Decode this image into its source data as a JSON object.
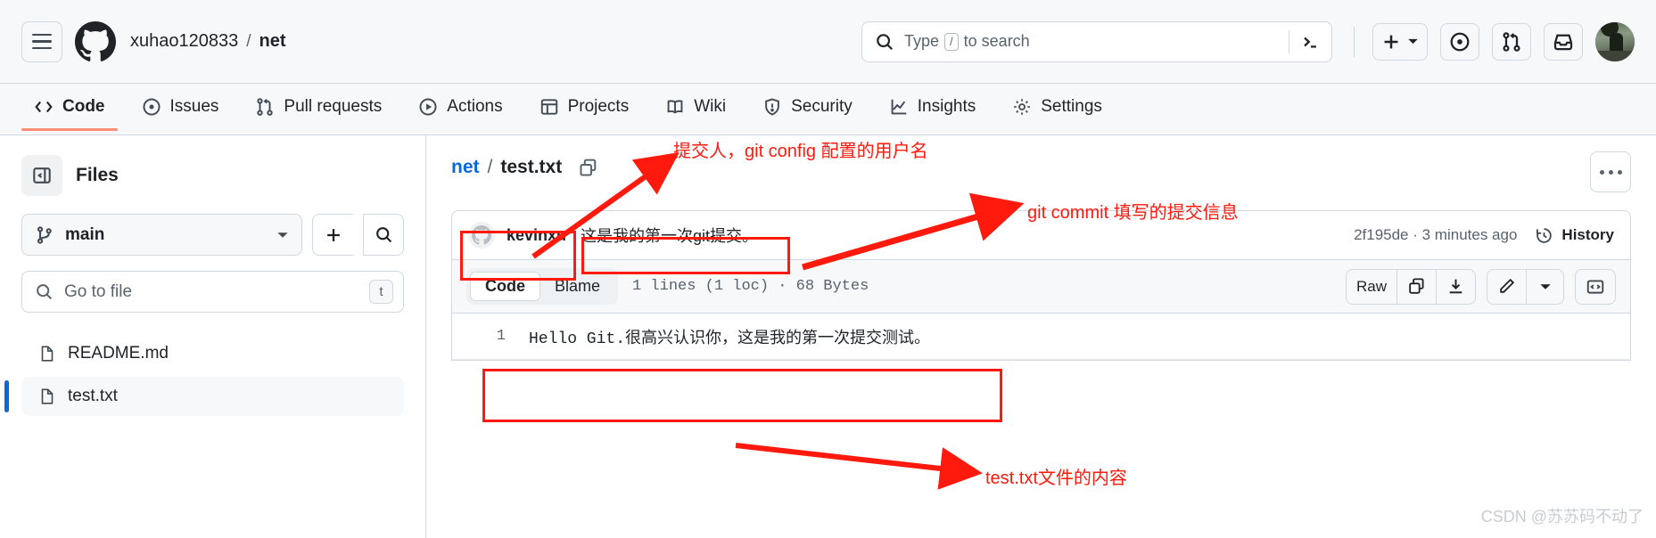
{
  "header": {
    "menu_icon": "hamburger-menu-icon",
    "logo_icon": "github-mark-icon",
    "owner": "xuhao120833",
    "separator": "/",
    "repo": "net",
    "search": {
      "placeholder_before": "Type",
      "placeholder_key": "/",
      "placeholder_after": "to search",
      "icon": "search-icon",
      "command_icon": "terminal-prompt-icon"
    },
    "actions": [
      {
        "name": "create-new-button",
        "icon": "plus-icon",
        "chevron": "chevron-down-icon"
      },
      {
        "name": "issues-button",
        "icon": "issue-opened-icon"
      },
      {
        "name": "pull-requests-button",
        "icon": "git-pull-request-icon"
      },
      {
        "name": "notifications-button",
        "icon": "inbox-icon"
      }
    ],
    "avatar": "user-avatar"
  },
  "nav": {
    "items": [
      {
        "label": "Code",
        "icon": "code-icon",
        "active": true
      },
      {
        "label": "Issues",
        "icon": "issue-opened-icon",
        "active": false
      },
      {
        "label": "Pull requests",
        "icon": "git-pull-request-icon",
        "active": false
      },
      {
        "label": "Actions",
        "icon": "play-icon",
        "active": false
      },
      {
        "label": "Projects",
        "icon": "table-icon",
        "active": false
      },
      {
        "label": "Wiki",
        "icon": "book-icon",
        "active": false
      },
      {
        "label": "Security",
        "icon": "shield-icon",
        "active": false
      },
      {
        "label": "Insights",
        "icon": "graph-icon",
        "active": false
      },
      {
        "label": "Settings",
        "icon": "gear-icon",
        "active": false
      }
    ],
    "active_underline_color": "#fd8c73"
  },
  "sidebar": {
    "title": "Files",
    "toggle_icon": "sidebar-collapse-icon",
    "branch": {
      "name": "main",
      "icon": "git-branch-icon",
      "chevron": "chevron-down-icon"
    },
    "add_button_icon": "plus-icon",
    "search_button_icon": "search-icon",
    "file_filter": {
      "placeholder": "Go to file",
      "icon": "search-icon",
      "shortcut": "t"
    },
    "files": [
      {
        "name": "README.md",
        "icon": "file-icon",
        "selected": false
      },
      {
        "name": "test.txt",
        "icon": "file-icon",
        "selected": true
      }
    ],
    "selected_marker_color": "#0969da"
  },
  "main": {
    "breadcrumb": {
      "dir": "net",
      "separator": "/",
      "file": "test.txt",
      "copy_icon": "copy-path-icon"
    },
    "more_options_icon": "kebab-horizontal-icon",
    "commit": {
      "avatar": "commit-author-avatar",
      "author": "kevinxu",
      "message": "这是我的第一次git提交。",
      "sha_and_time": "2f195de · 3 minutes ago",
      "history_label": "History",
      "history_icon": "history-icon"
    },
    "file_toolbar": {
      "tabs": [
        {
          "label": "Code",
          "active": true
        },
        {
          "label": "Blame",
          "active": false
        }
      ],
      "meta": "1 lines (1 loc) · 68 Bytes",
      "raw_label": "Raw",
      "copy_icon": "copy-icon",
      "download_icon": "download-icon",
      "edit_icon": "pencil-icon",
      "edit_chevron_icon": "chevron-down-icon",
      "symbols_icon": "code-brackets-icon"
    },
    "code": {
      "lines": [
        {
          "number": "1",
          "text": "Hello Git.很高兴认识你，这是我的第一次提交测试。"
        }
      ]
    }
  },
  "annotations": {
    "color": "#ff1a0d",
    "labels": [
      {
        "name": "annotation-committer",
        "text": "提交人，git config 配置的用户名"
      },
      {
        "name": "annotation-commit-message",
        "text": "git commit 填写的提交信息"
      },
      {
        "name": "annotation-file-content",
        "text": "test.txt文件的内容"
      }
    ]
  },
  "watermark": "CSDN @苏苏码不动了"
}
